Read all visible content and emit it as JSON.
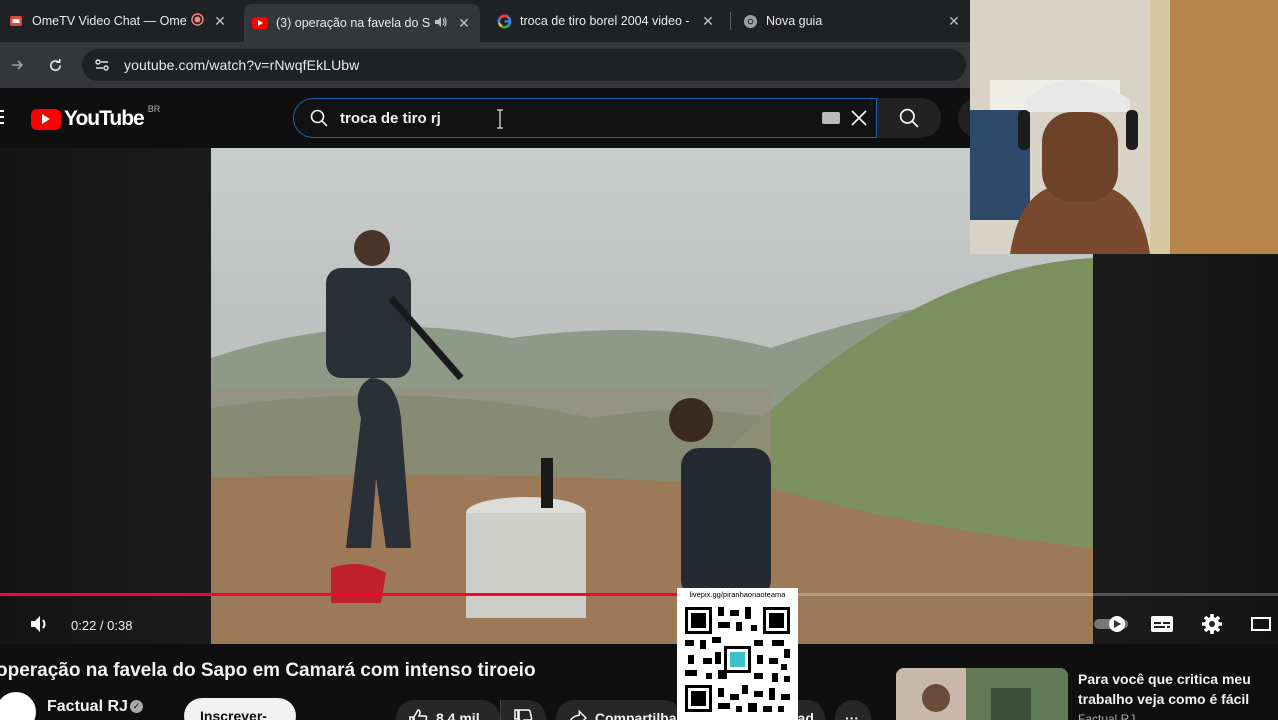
{
  "browser": {
    "tabs": [
      {
        "title": "OmeTV Video Chat — Ome",
        "active": false
      },
      {
        "title": "(3) operação na favela do S",
        "active": true
      },
      {
        "title": "troca de tiro borel 2004 video -",
        "active": false
      },
      {
        "title": "Nova guia",
        "active": false
      }
    ],
    "url": "youtube.com/watch?v=rNwqfEkLUbw"
  },
  "youtube": {
    "logo_text": "YouTube",
    "country_code": "BR",
    "search_query": "troca de tiro rj"
  },
  "player": {
    "time_display": "0:22 / 0:38",
    "progress": 0.579,
    "colors": {
      "progress": "#ff0033"
    }
  },
  "video_info": {
    "title": "operação na favela do Sapo em Camará com intenso tiroeio",
    "channel": "Factual RJ",
    "subscribe_label": "Inscrever-se",
    "likes": "8,4 mil",
    "share_label": "Compartilhar",
    "download_label": "Download",
    "more_label": "···"
  },
  "overlay": {
    "qr_caption": "livepix.gg/piranhaonaoteama"
  },
  "recommendation": {
    "title": "Para você que  critica meu trabalho veja como é fácil",
    "channel": "Factual RJ"
  }
}
